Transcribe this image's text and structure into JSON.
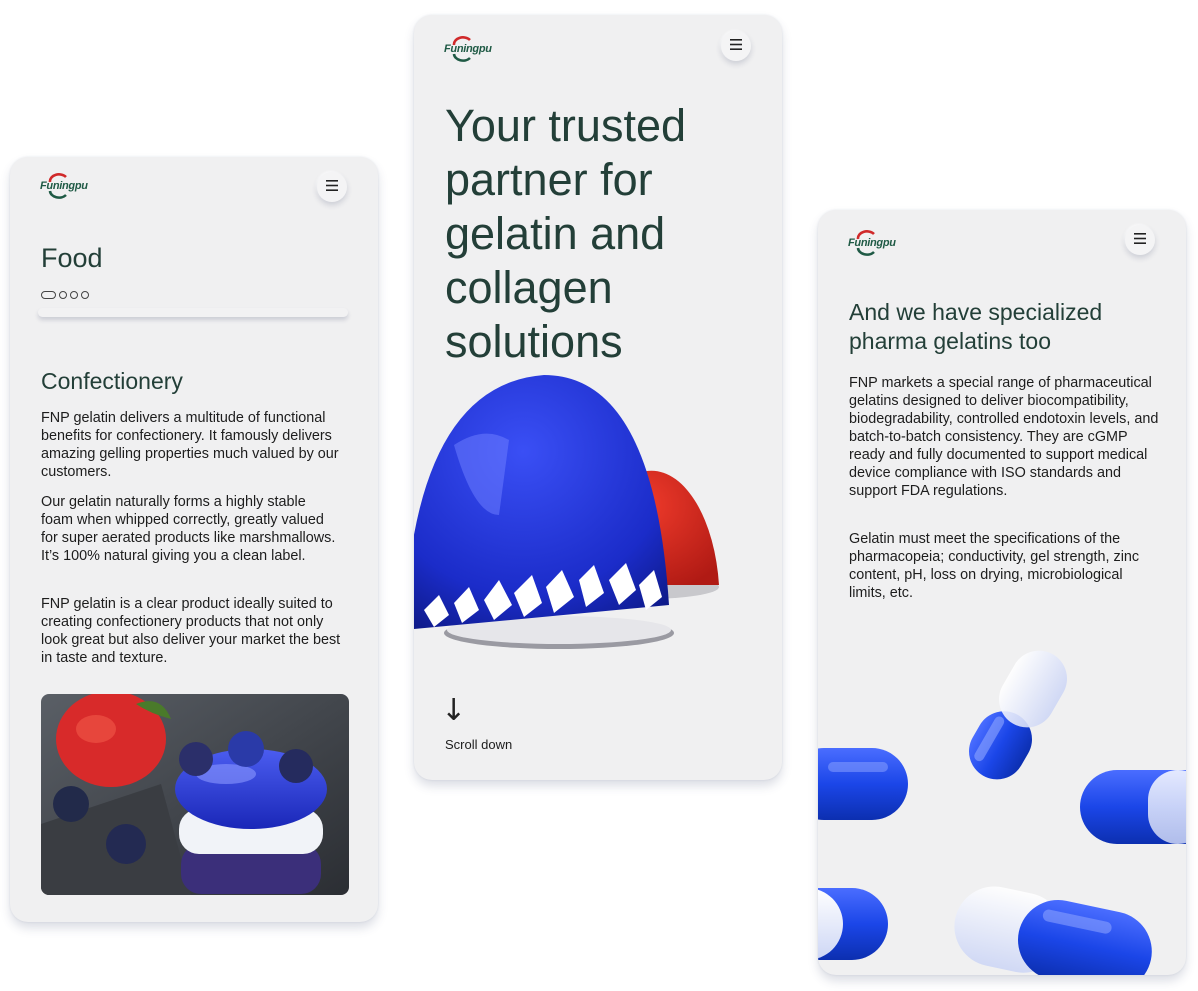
{
  "brand": {
    "logo_text": "Funingpu"
  },
  "colors": {
    "heading": "#233f38",
    "logo_green": "#1f5a45",
    "logo_red": "#d0292a",
    "card_bg": "#f0f0f1"
  },
  "icons": {
    "menu": "hamburger-menu-icon",
    "scroll": "arrow-down-icon"
  },
  "food_screen": {
    "page_title": "Food",
    "carousel": {
      "total_slides": 4,
      "active_index": 0
    },
    "section_title": "Confectionery",
    "paragraphs": [
      "FNP gelatin delivers a multitude of functional benefits for confectionery. It famously delivers amazing gelling properties much valued by our customers.",
      "Our gelatin naturally forms a highly stable foam when whipped correctly, greatly valued for super aerated products like marshmallows. It’s 100% natural giving you a clean label.",
      "FNP gelatin is a clear product ideally suited to creating confectionery products that not only look great but also deliver your market the best in taste and texture."
    ]
  },
  "hero_screen": {
    "headline": "Your trusted partner for gelatin and collagen solutions",
    "scroll_label": "Scroll down"
  },
  "pharma_screen": {
    "title": "And we have specialized pharma gelatins too",
    "paragraphs": [
      "FNP markets a special range of pharmaceutical gelatins designed to deliver biocompatibility, biodegradability, controlled endotoxin levels, and batch-to-batch consistency. They are cGMP ready and fully documented to support medical device compliance with ISO standards and support FDA regulations.",
      "Gelatin must meet the specifications of the pharmacopeia; conductivity, gel strength, zinc content, pH, loss on drying, microbiological limits, etc."
    ]
  }
}
